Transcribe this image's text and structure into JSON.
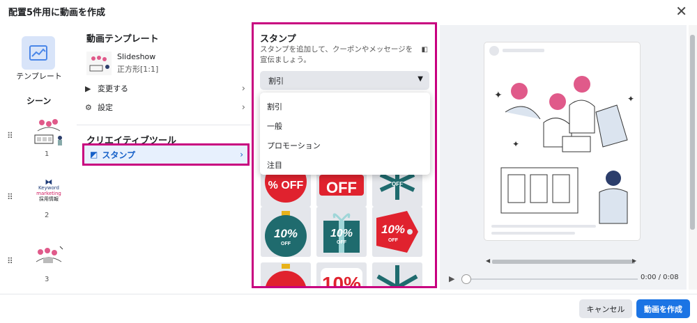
{
  "dialog": {
    "title": "配置5件用に動画を作成",
    "close_icon": "close-icon"
  },
  "scene_panel": {
    "template_label": "テンプレート",
    "scenes_heading": "シーン",
    "scenes": [
      {
        "number": "1",
        "thumb": "illustration-thumbnail"
      },
      {
        "number": "2",
        "thumb": "logo-thumbnail",
        "logo_line1": "Keyword",
        "logo_line2": "marketing",
        "logo_line3": "採用情報"
      },
      {
        "number": "3",
        "thumb": "illustration-thumbnail"
      }
    ]
  },
  "settings": {
    "template_heading": "動画テンプレート",
    "template_name": "Slideshow",
    "template_ratio": "正方形[1:1]",
    "change_label": "変更する",
    "settings_label": "設定",
    "creative_heading": "クリエイティブツール",
    "stamp_label": "スタンプ"
  },
  "stamp_panel": {
    "title": "スタンプ",
    "description": "スタンプを追加して、クーポンやメッセージを宣伝ましょう。",
    "category_selected": "割引",
    "dropdown_options": [
      "割引",
      "一般",
      "プロモーション",
      "注目"
    ],
    "stamps": [
      {
        "name": "30-off-stamp",
        "text": "% OFF"
      },
      {
        "name": "off-stamp",
        "text": "OFF"
      },
      {
        "name": "snowflake-off-stamp",
        "text": "OFF"
      },
      {
        "name": "ornament-10-off-stamp",
        "text": "10%",
        "sub": "OFF"
      },
      {
        "name": "gift-10-off-stamp",
        "text": "10%",
        "sub": "OFF"
      },
      {
        "name": "tag-10-off-stamp",
        "text": "10%",
        "sub": "OFF"
      },
      {
        "name": "ornament-red-stamp",
        "text": ""
      },
      {
        "name": "10-percent-stamp",
        "text": "10%"
      },
      {
        "name": "snowflake-stamp",
        "text": ""
      }
    ]
  },
  "preview": {
    "time": "0:00 / 0:08"
  },
  "footer": {
    "cancel_label": "キャンセル",
    "create_label": "動画を作成"
  },
  "colors": {
    "highlight": "#c8007f",
    "primary": "#1b74e4",
    "stamp_red": "#e0222e",
    "stamp_teal": "#1f6b6e"
  }
}
